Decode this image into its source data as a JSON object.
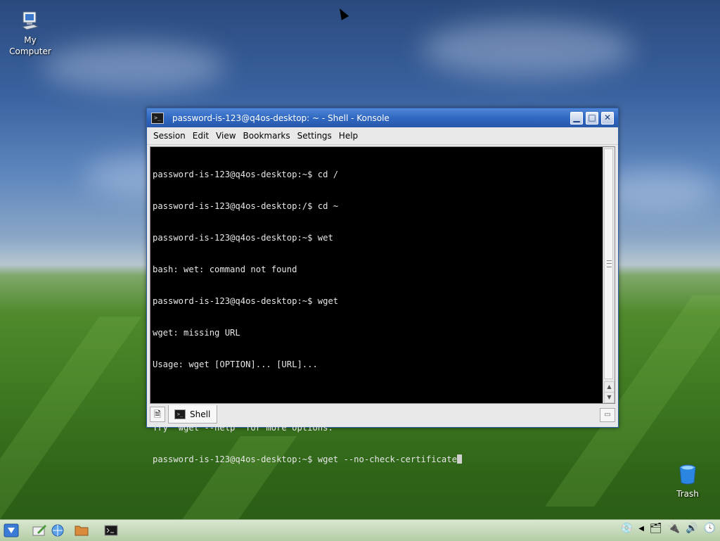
{
  "desktop": {
    "icons": [
      {
        "label": "My\nComputer",
        "icon": "computer-icon"
      },
      {
        "label": "Trash",
        "icon": "trash-icon"
      }
    ]
  },
  "window": {
    "title": "password-is-123@q4os-desktop: ~ - Shell - Konsole",
    "controls": {
      "minimize": "▁",
      "maximize": "□",
      "close": "✕"
    },
    "menu": [
      "Session",
      "Edit",
      "View",
      "Bookmarks",
      "Settings",
      "Help"
    ],
    "terminal": {
      "lines": [
        "password-is-123@q4os-desktop:~$ cd /",
        "password-is-123@q4os-desktop:/$ cd ~",
        "password-is-123@q4os-desktop:~$ wet",
        "bash: wet: command not found",
        "password-is-123@q4os-desktop:~$ wget",
        "wget: missing URL",
        "Usage: wget [OPTION]... [URL]...",
        "",
        "Try `wget --help' for more options.",
        "password-is-123@q4os-desktop:~$ wget --no-check-certificate"
      ]
    },
    "tabs": [
      {
        "label": "Shell"
      }
    ]
  },
  "taskbar": {
    "items": [
      "start-menu-icon",
      "edit-icon",
      "network-icon",
      "folder-icon",
      "konsole-icon"
    ],
    "tray": [
      "cd-icon",
      "arrow-left-icon",
      "app-icon",
      "link-icon",
      "volume-icon",
      "clock-icon"
    ]
  },
  "colors": {
    "titlebar": "#2f66bf",
    "terminal_bg": "#000000",
    "terminal_fg": "#e6e6e6"
  }
}
